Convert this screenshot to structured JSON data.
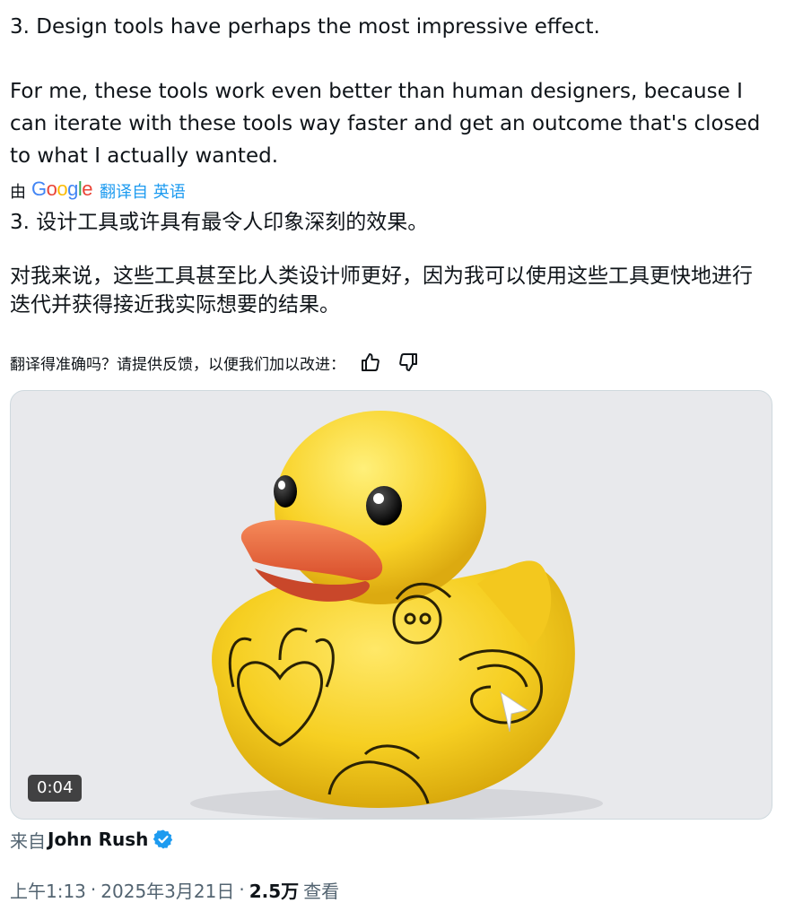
{
  "tweet": {
    "line_1": "3. Design tools have perhaps the most impressive effect.",
    "line_2": "For me, these tools work even better than human designers, because I can iterate with these tools way faster and get an outcome that's closed to what I actually wanted."
  },
  "translation": {
    "by_label": "由",
    "provider_logo": "Google",
    "translated_from": "翻译自 英语",
    "line_1": "3. 设计工具或许具有最令人印象深刻的效果。",
    "line_2": "对我来说，这些工具甚至比人类设计师更好，因为我可以使用这些工具更快地进行迭代并获得接近我实际想要的结果。",
    "feedback_prompt": "翻译得准确吗？请提供反馈，以便我们加以改进：",
    "thumbs_up_icon": "thumbs-up-icon",
    "thumbs_down_icon": "thumbs-down-icon"
  },
  "media": {
    "type": "video",
    "duration": "0:04",
    "background_color": "#e8e9ec"
  },
  "source": {
    "prefix": "来自",
    "author": "John Rush",
    "verified_icon": "verified-badge-icon",
    "verified_color": "#1d9bf0"
  },
  "meta": {
    "time": "上午1:13",
    "separator": "·",
    "date": "2025年3月21日",
    "views_count": "2.5万",
    "views_label": "查看"
  }
}
